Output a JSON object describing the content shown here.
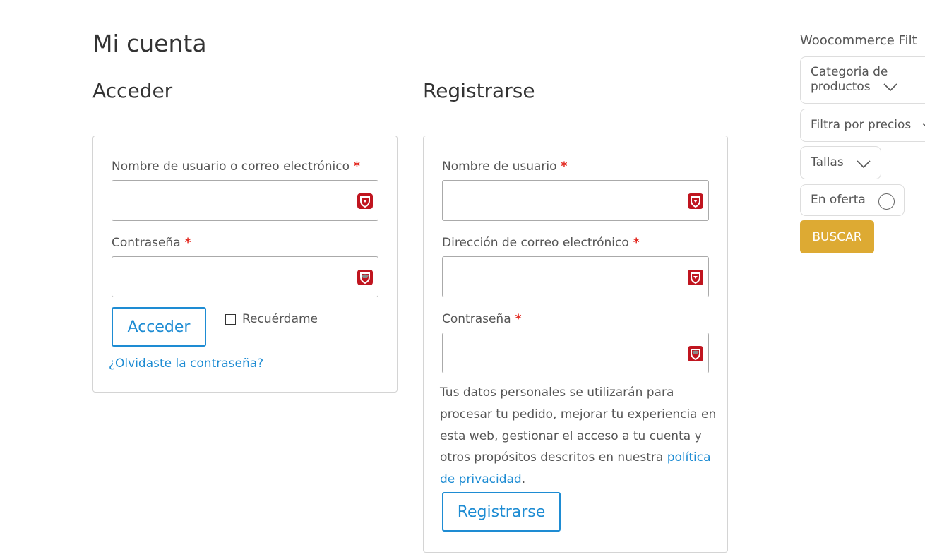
{
  "page": {
    "title": "Mi cuenta"
  },
  "login": {
    "heading": "Acceder",
    "username_label": "Nombre de usuario o correo electrónico",
    "username_value": "",
    "password_label": "Contraseña",
    "password_value": "",
    "required_mark": "*",
    "submit_label": "Acceder",
    "remember_label": "Recuérdame",
    "remember_checked": false,
    "lost_password_link": "¿Olvidaste la contraseña?"
  },
  "register": {
    "heading": "Registrarse",
    "username_label": "Nombre de usuario",
    "email_label": "Dirección de correo electrónico",
    "password_label": "Contraseña",
    "required_mark": "*",
    "privacy_text": "Tus datos personales se utilizarán para procesar tu pedido, mejorar tu experiencia en esta web, gestionar el acceso a tu cuenta y otros propósitos descritos en nuestra",
    "privacy_link": "política de privacidad",
    "privacy_end": ".",
    "submit_label": "Registrarse"
  },
  "sidebar": {
    "title": "Woocommerce Filt",
    "filters": {
      "category_label": "Categoria de productos",
      "price_label": "Filtra por precios",
      "sizes_label": "Tallas",
      "sale_label": "En oferta"
    },
    "search_button": "BUSCAR"
  },
  "colors": {
    "link": "#1e8cd3",
    "required": "#e2231a",
    "search_button": "#ddaa33",
    "password_manager_icon": "#c0151f"
  },
  "icons": {
    "password_manager": "password-manager-icon",
    "chevron": "chevron-down-icon",
    "toggle": "toggle-circle-icon",
    "checkbox": "checkbox-icon"
  }
}
